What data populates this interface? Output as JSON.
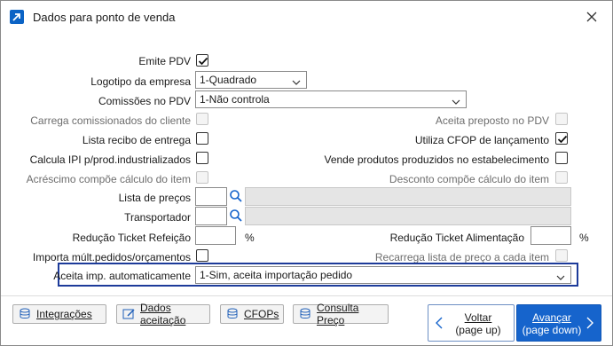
{
  "window": {
    "title": "Dados para ponto de venda",
    "app_icon": "arrow-up-right-icon",
    "close_icon": "close-icon"
  },
  "fields": {
    "emite_pdv": {
      "label": "Emite PDV",
      "checked": true
    },
    "logotipo": {
      "label": "Logotipo da empresa",
      "value": "1-Quadrado"
    },
    "comissoes": {
      "label": "Comissões no PDV",
      "value": "1-Não controla"
    },
    "carrega_comissionados": {
      "label": "Carrega comissionados do cliente",
      "checked": false,
      "disabled": true
    },
    "aceita_preposto": {
      "label": "Aceita preposto no PDV",
      "checked": false,
      "disabled": true
    },
    "lista_recibo": {
      "label": "Lista recibo de entrega",
      "checked": false
    },
    "utiliza_cfop": {
      "label": "Utiliza CFOP de lançamento",
      "checked": true
    },
    "calcula_ipi": {
      "label": "Calcula IPI p/prod.industrializados",
      "checked": false
    },
    "vende_produtos": {
      "label": "Vende produtos produzidos no estabelecimento",
      "checked": false
    },
    "acrescimo": {
      "label": "Acréscimo compõe cálculo do item",
      "checked": false,
      "disabled": true
    },
    "desconto": {
      "label": "Desconto compõe cálculo do item",
      "checked": false,
      "disabled": true
    },
    "lista_precos": {
      "label": "Lista de preços",
      "code": "",
      "description": ""
    },
    "transportador": {
      "label": "Transportador",
      "code": "",
      "description": ""
    },
    "reducao_refeicao": {
      "label": "Redução Ticket Refeição",
      "value": "",
      "unit": "%"
    },
    "reducao_alimentacao": {
      "label": "Redução Ticket Alimentação",
      "value": "",
      "unit": "%"
    },
    "importa_mult": {
      "label": "Importa múlt.pedidos/orçamentos",
      "checked": false
    },
    "recarrega_lista": {
      "label": "Recarrega lista de preço a cada item",
      "checked": false,
      "disabled": true
    },
    "aceita_imp": {
      "label": "Aceita imp. automaticamente",
      "value": "1-Sim, aceita importação pedido"
    }
  },
  "footer": {
    "buttons": [
      {
        "label": "Integrações",
        "icon": "database-icon"
      },
      {
        "label": "Dados aceitação",
        "icon": "edit-icon"
      },
      {
        "label": "CFOPs",
        "icon": "database-icon"
      },
      {
        "label": "Consulta Preço",
        "icon": "database-icon"
      }
    ],
    "back": {
      "label": "Voltar",
      "hint": "(page up)"
    },
    "next": {
      "label": "Avançar",
      "hint": "(page down)"
    }
  },
  "colors": {
    "accent": "#1664cc",
    "highlight_border": "#1d3b9a",
    "disabled_text": "#6d6d6d"
  }
}
